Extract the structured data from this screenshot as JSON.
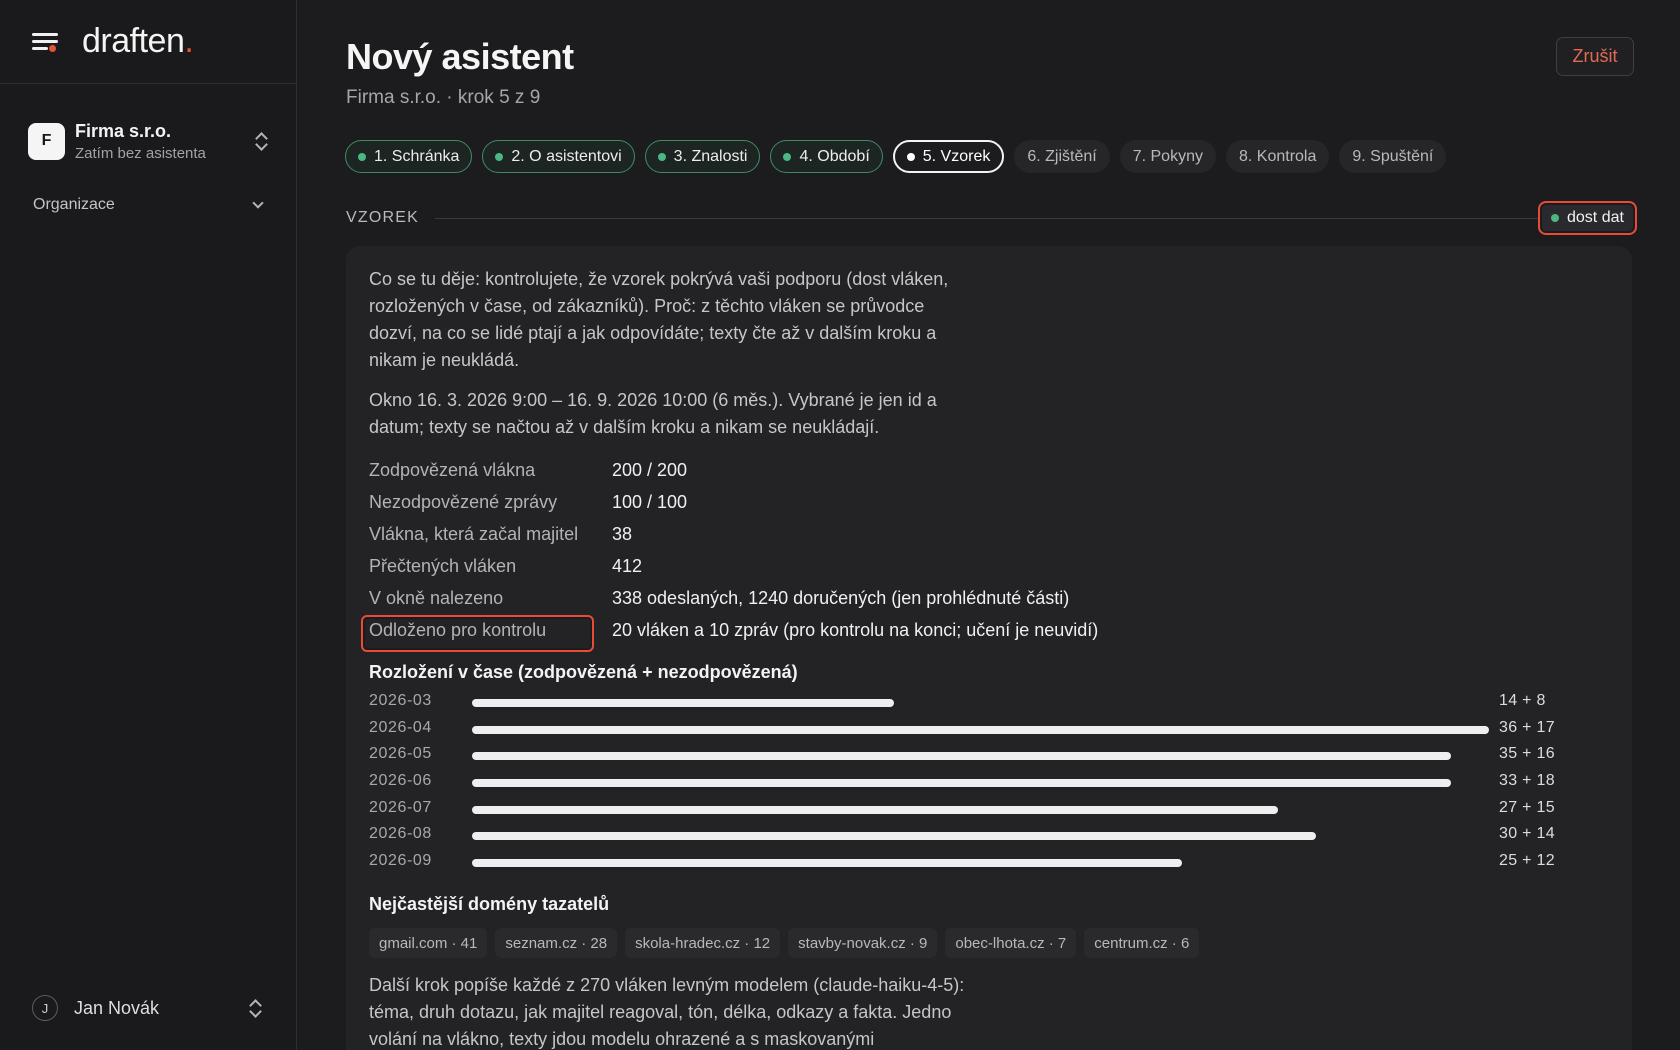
{
  "app": {
    "brand_main": "draften",
    "brand_dot": "."
  },
  "sidebar": {
    "org_initial": "F",
    "org_name": "Firma s.r.o.",
    "org_sub": "Zatím bez asistenta",
    "section_label": "Organizace",
    "user_initial": "J",
    "user_name": "Jan Novák"
  },
  "page": {
    "title": "Nový asistent",
    "subtitle": "Firma s.r.o. · krok 5 z 9",
    "cancel_label": "Zrušit"
  },
  "steps": [
    {
      "label": "1. Schránka",
      "state": "done"
    },
    {
      "label": "2. O asistentovi",
      "state": "done"
    },
    {
      "label": "3. Znalosti",
      "state": "done"
    },
    {
      "label": "4. Období",
      "state": "done"
    },
    {
      "label": "5. Vzorek",
      "state": "current"
    },
    {
      "label": "6. Zjištění",
      "state": "todo"
    },
    {
      "label": "7. Pokyny",
      "state": "todo"
    },
    {
      "label": "8. Kontrola",
      "state": "todo"
    },
    {
      "label": "9. Spuštění",
      "state": "todo"
    }
  ],
  "section": {
    "label": "VZOREK",
    "status": "dost dat",
    "status_color": "#4cb784"
  },
  "content": {
    "intro": "Co se tu děje: kontrolujete, že vzorek pokrývá vaši podporu (dost vláken, rozložených v čase, od zákazníků). Proč: z těchto vláken se průvodce dozví, na co se lidé ptají a jak odpovídáte; texty čte až v dalším kroku a nikam je neukládá.",
    "window": "Okno 16. 3. 2026 9:00 – 16. 9. 2026 10:00 (6 měs.). Vybrané je jen id a datum; texty se načtou až v dalším kroku a nikam se neukládají.",
    "facts": [
      {
        "label": "Zodpovězená vlákna",
        "value": "200 / 200"
      },
      {
        "label": "Nezodpovězené zprávy",
        "value": "100 / 100"
      },
      {
        "label": "Vlákna, která začal majitel",
        "value": "38"
      },
      {
        "label": "Přečtených vláken",
        "value": "412"
      },
      {
        "label": "V okně nalezeno",
        "value": "338 odeslaných, 1240 doručených (jen prohlédnuté části)"
      },
      {
        "label": "Odloženo pro kontrolu",
        "value": "20 vláken a 10 zpráv (pro kontrolu na konci; učení je neuvidí)"
      }
    ],
    "timeline_title": "Rozložení v čase (zodpovězená + nezodpovězená)",
    "domains_title": "Nejčastější domény tazatelů",
    "domains": [
      "gmail.com · 41",
      "seznam.cz · 28",
      "skola-hradec.cz · 12",
      "stavby-novak.cz · 9",
      "obec-lhota.cz · 7",
      "centrum.cz · 6"
    ],
    "next_step": "Další krok popíše každé z 270 vláken levným modelem (claude-haiku-4-5): téma, druh dotazu, jak majitel reagoval, tón, délka, odkazy a fakta. Jedno volání na vlákno, texty jdou modelu ohrazené a s maskovanými"
  },
  "chart_data": {
    "type": "bar",
    "title": "Rozložení v čase (zodpovězená + nezodpovězená)",
    "categories": [
      "2026-03",
      "2026-04",
      "2026-05",
      "2026-06",
      "2026-07",
      "2026-08",
      "2026-09"
    ],
    "series": [
      {
        "values": [
          14,
          36,
          35,
          33,
          27,
          30,
          25
        ]
      },
      {
        "values": [
          8,
          17,
          16,
          18,
          15,
          14,
          12
        ]
      }
    ],
    "value_labels": [
      "14 + 8",
      "36 + 17",
      "35 + 16",
      "33 + 18",
      "27 + 15",
      "30 + 14",
      "25 + 12"
    ],
    "stacked": true,
    "orientation": "horizontal",
    "grid": false,
    "bar_color": "#efefef"
  }
}
